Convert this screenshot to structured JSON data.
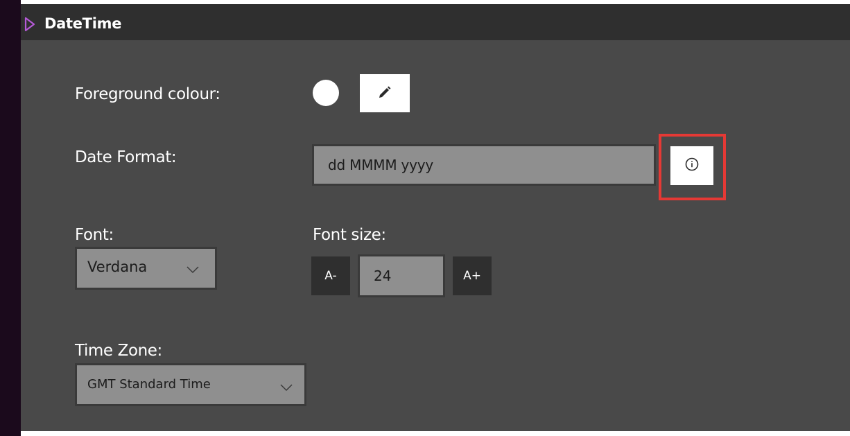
{
  "section": {
    "title": "DateTime"
  },
  "foreground": {
    "label": "Foreground colour:",
    "color": "#ffffff",
    "edit_icon": "pencil-icon"
  },
  "date_format": {
    "label": "Date Format:",
    "value": "dd MMMM yyyy",
    "info_icon": "info-icon"
  },
  "font": {
    "label": "Font:",
    "value": "Verdana"
  },
  "font_size": {
    "label": "Font size:",
    "decrease_label": "A-",
    "value": "24",
    "increase_label": "A+"
  },
  "time_zone": {
    "label": "Time Zone:",
    "value": "GMT Standard Time"
  },
  "colors": {
    "panel_bg": "#494949",
    "header_bg": "#2f2f2f",
    "accent": "#b65ad8",
    "highlight": "#e53935"
  }
}
